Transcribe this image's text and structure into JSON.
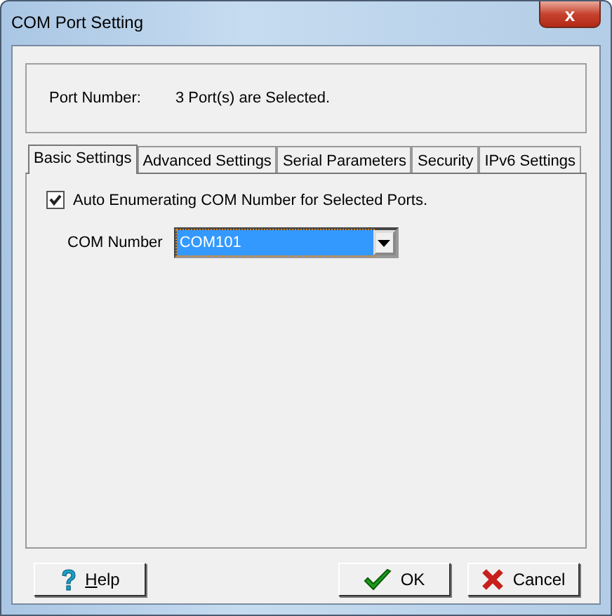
{
  "window": {
    "title": "COM Port Setting",
    "close": "x"
  },
  "port_number": {
    "label": "Port Number:",
    "value": "3 Port(s) are Selected."
  },
  "tabs": [
    {
      "label": "Basic Settings",
      "selected": true
    },
    {
      "label": "Advanced Settings",
      "selected": false
    },
    {
      "label": "Serial Parameters",
      "selected": false
    },
    {
      "label": "Security",
      "selected": false
    },
    {
      "label": "IPv6 Settings",
      "selected": false
    }
  ],
  "auto_enumerate": {
    "label": "Auto Enumerating COM Number for Selected Ports.",
    "checked": true
  },
  "com_number": {
    "label": "COM Number",
    "value": "COM101"
  },
  "buttons": [
    {
      "kind": "help",
      "label": "Help"
    },
    {
      "kind": "ok",
      "label": "OK"
    },
    {
      "kind": "cancel",
      "label": "Cancel"
    }
  ]
}
